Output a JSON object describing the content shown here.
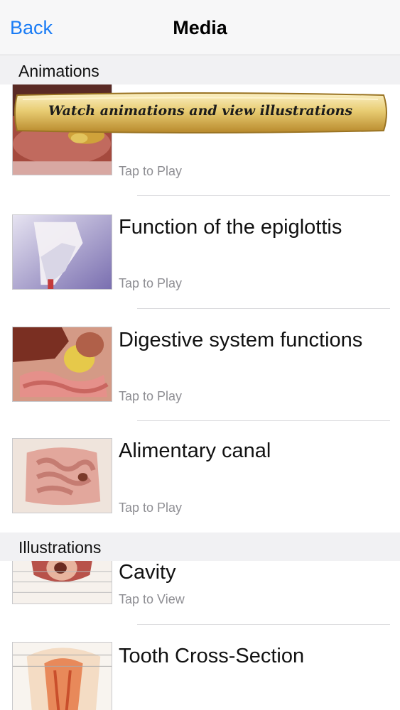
{
  "navbar": {
    "back_label": "Back",
    "title": "Media"
  },
  "sections": {
    "animations": "Animations",
    "illustrations": "Illustrations"
  },
  "banner": {
    "text": "Watch animations and view illustrations"
  },
  "animations": [
    {
      "title": "",
      "subtitle": "Tap to Play"
    },
    {
      "title": "Function of the epiglottis",
      "subtitle": "Tap to Play"
    },
    {
      "title": "Digestive system functions",
      "subtitle": "Tap to Play"
    },
    {
      "title": "Alimentary canal",
      "subtitle": "Tap to Play"
    }
  ],
  "illustrations": [
    {
      "title": "Cavity",
      "subtitle": "Tap to View"
    },
    {
      "title": "Tooth Cross-Section",
      "subtitle": ""
    }
  ],
  "colors": {
    "accent": "#1a7cf5",
    "banner_gold": "#d9b54a"
  }
}
